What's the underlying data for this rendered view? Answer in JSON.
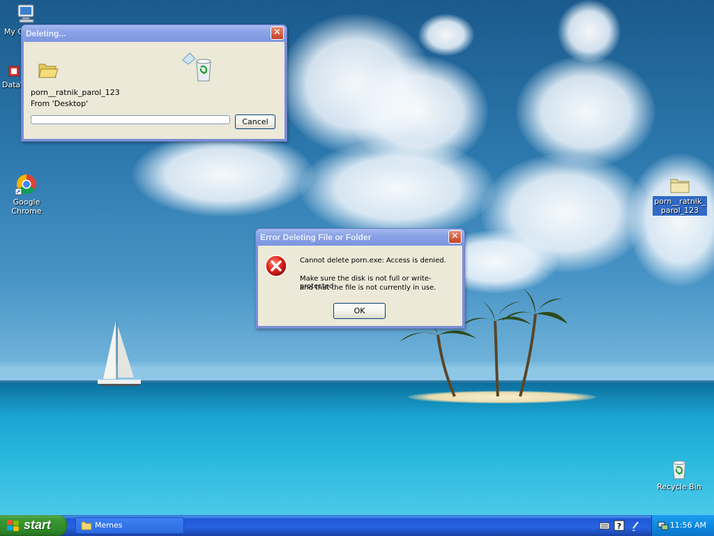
{
  "desktop": {
    "icons": [
      {
        "label": "My C",
        "icon": "my-computer-icon"
      },
      {
        "label": "DataV",
        "icon": "data-app-icon"
      },
      {
        "label": "Google Chrome",
        "icon": "chrome-icon"
      },
      {
        "label": "porn__ratnik_parol_123",
        "icon": "folder-icon"
      },
      {
        "label": "Recycle Bin",
        "icon": "recycle-bin-icon"
      }
    ]
  },
  "deleting_dialog": {
    "title": "Deleting...",
    "file_name": "porn__ratnik_parol_123",
    "from_text": "From 'Desktop'",
    "cancel_label": "Cancel",
    "progress": 0
  },
  "error_dialog": {
    "title": "Error Deleting File or Folder",
    "message": "Cannot delete porn.exe: Access is denied.",
    "detail_line1": "Make sure the disk is not full or write-protected",
    "detail_line2": "and that the file is not currently in use.",
    "ok_label": "OK"
  },
  "taskbar": {
    "start_label": "start",
    "items": [
      {
        "label": "Memes",
        "icon": "folder-icon"
      }
    ],
    "tray_icons": [
      "keyboard-icon",
      "help-icon",
      "pen-icon",
      "network-icon"
    ],
    "clock": "11:56 AM"
  },
  "colors": {
    "xp_blue": "#0055e5",
    "start_green": "#3c9a33",
    "dialog_face": "#ece9d8",
    "error_red": "#d9261c"
  }
}
